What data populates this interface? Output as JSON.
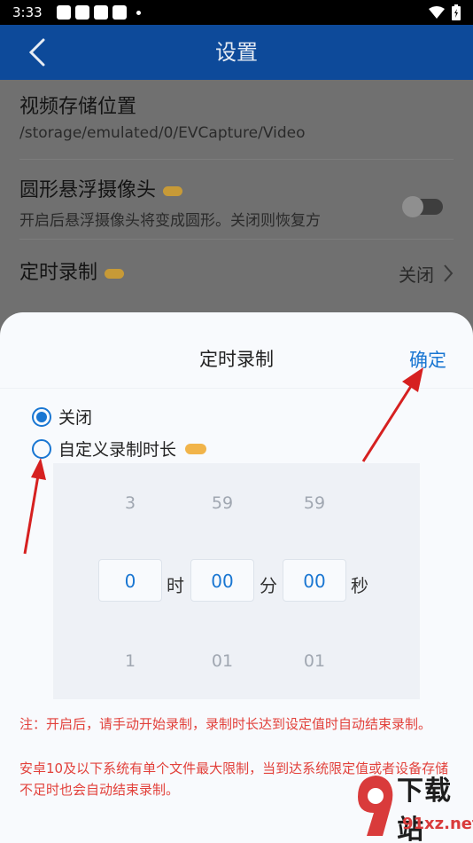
{
  "status_bar": {
    "time": "3:33"
  },
  "header": {
    "title": "设置"
  },
  "settings": {
    "storage": {
      "title": "视频存储位置",
      "path": "/storage/emulated/0/EVCapture/Video"
    },
    "round_camera": {
      "title": "圆形悬浮摄像头",
      "desc": "开启后悬浮摄像头将变成圆形。关闭则恢复方"
    },
    "timer": {
      "title": "定时录制",
      "value": "关闭"
    }
  },
  "sheet": {
    "title": "定时录制",
    "confirm_label": "确定",
    "options": [
      {
        "label": "关闭",
        "selected": true
      },
      {
        "label": "自定义录制时长",
        "selected": false
      }
    ],
    "picker": {
      "above": [
        "3",
        "59",
        "59"
      ],
      "current": [
        "0",
        "00",
        "00"
      ],
      "below": [
        "1",
        "01",
        "01"
      ],
      "units": [
        "时",
        "分",
        "秒"
      ]
    },
    "notes": [
      "注：开启后，请手动开始录制，录制时长达到设定值时自动结束录制。",
      "安卓10及以下系统有单个文件最大限制，当到达系统限定值或者设备存储不足时也会自动结束录制。"
    ]
  },
  "watermark": {
    "big": "下载站",
    "small": "91xz.net"
  },
  "colors": {
    "accent": "#1976d2",
    "header": "#0d4a9a",
    "note": "#e2413b",
    "annotation_arrow": "#d62020"
  }
}
